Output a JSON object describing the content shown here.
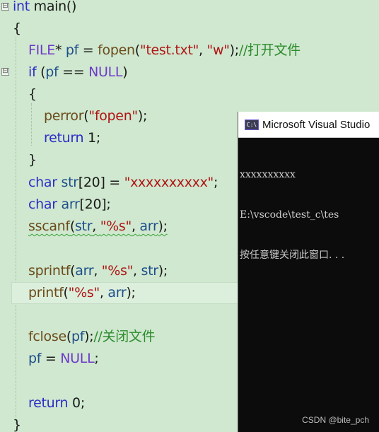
{
  "editor": {
    "line1": {
      "kw": "int",
      "name": " main()"
    },
    "line2": {
      "brace": "{"
    },
    "line3": {
      "macro": "FILE",
      "p1": "* ",
      "var": "pf",
      "p2": " = ",
      "fn": "fopen",
      "p3": "(",
      "s1": "\"test.txt\"",
      "p4": ", ",
      "s2": "\"w\"",
      "p5": ");",
      "comment": "//打开文件"
    },
    "line4": {
      "kw": "if",
      "p1": " (",
      "var": "pf",
      "p2": " == ",
      "macro": "NULL",
      "p3": ")"
    },
    "line5": {
      "brace": "{"
    },
    "line6": {
      "fn": "perror",
      "p1": "(",
      "str": "\"fopen\"",
      "p2": ");"
    },
    "line7": {
      "kw": "return",
      "p1": " 1;"
    },
    "line8": {
      "brace": "}"
    },
    "line9": {
      "kw": "char",
      "p1": " ",
      "var": "str",
      "p2": "[20] = ",
      "str": "\"xxxxxxxxxx\"",
      "p3": ";"
    },
    "line10": {
      "kw": "char",
      "p1": " ",
      "var": "arr",
      "p2": "[20];"
    },
    "line11": {
      "fn": "sscanf",
      "p1": "(",
      "var1": "str",
      "p2": ", ",
      "str": "\"%s\"",
      "p3": ", ",
      "var2": "arr",
      "p4": ");"
    },
    "line13": {
      "fn": "sprintf",
      "p1": "(",
      "var1": "arr",
      "p2": ", ",
      "str": "\"%s\"",
      "p3": ", ",
      "var2": "str",
      "p4": ");"
    },
    "line14": {
      "fn": "printf",
      "p1": "(",
      "str": "\"%s\"",
      "p2": ", ",
      "var": "arr",
      "p3": ");"
    },
    "line16": {
      "fn": "fclose",
      "p1": "(",
      "var": "pf",
      "p2": ");",
      "comment": "//关闭文件"
    },
    "line17": {
      "var": "pf",
      "p1": " = ",
      "macro": "NULL",
      "p2": ";"
    },
    "line19": {
      "kw": "return",
      "p1": " 0;"
    },
    "line20": {
      "brace": "}"
    },
    "fold_symbol": "⊟"
  },
  "console": {
    "icon": "C:\\",
    "title": "Microsoft Visual Studio",
    "output_line1": "xxxxxxxxxx",
    "output_line2": "E:\\vscode\\test_c\\tes",
    "output_line3": "按任意键关闭此窗口. . ."
  },
  "watermark": "CSDN @bite_pch",
  "colors": {
    "editor_bg": "#cfe8cf",
    "keyword": "#2d2dc8",
    "string": "#b01515",
    "comment": "#2e8b2e",
    "macro": "#6f39c9",
    "console_bg": "#0c0c0c"
  }
}
